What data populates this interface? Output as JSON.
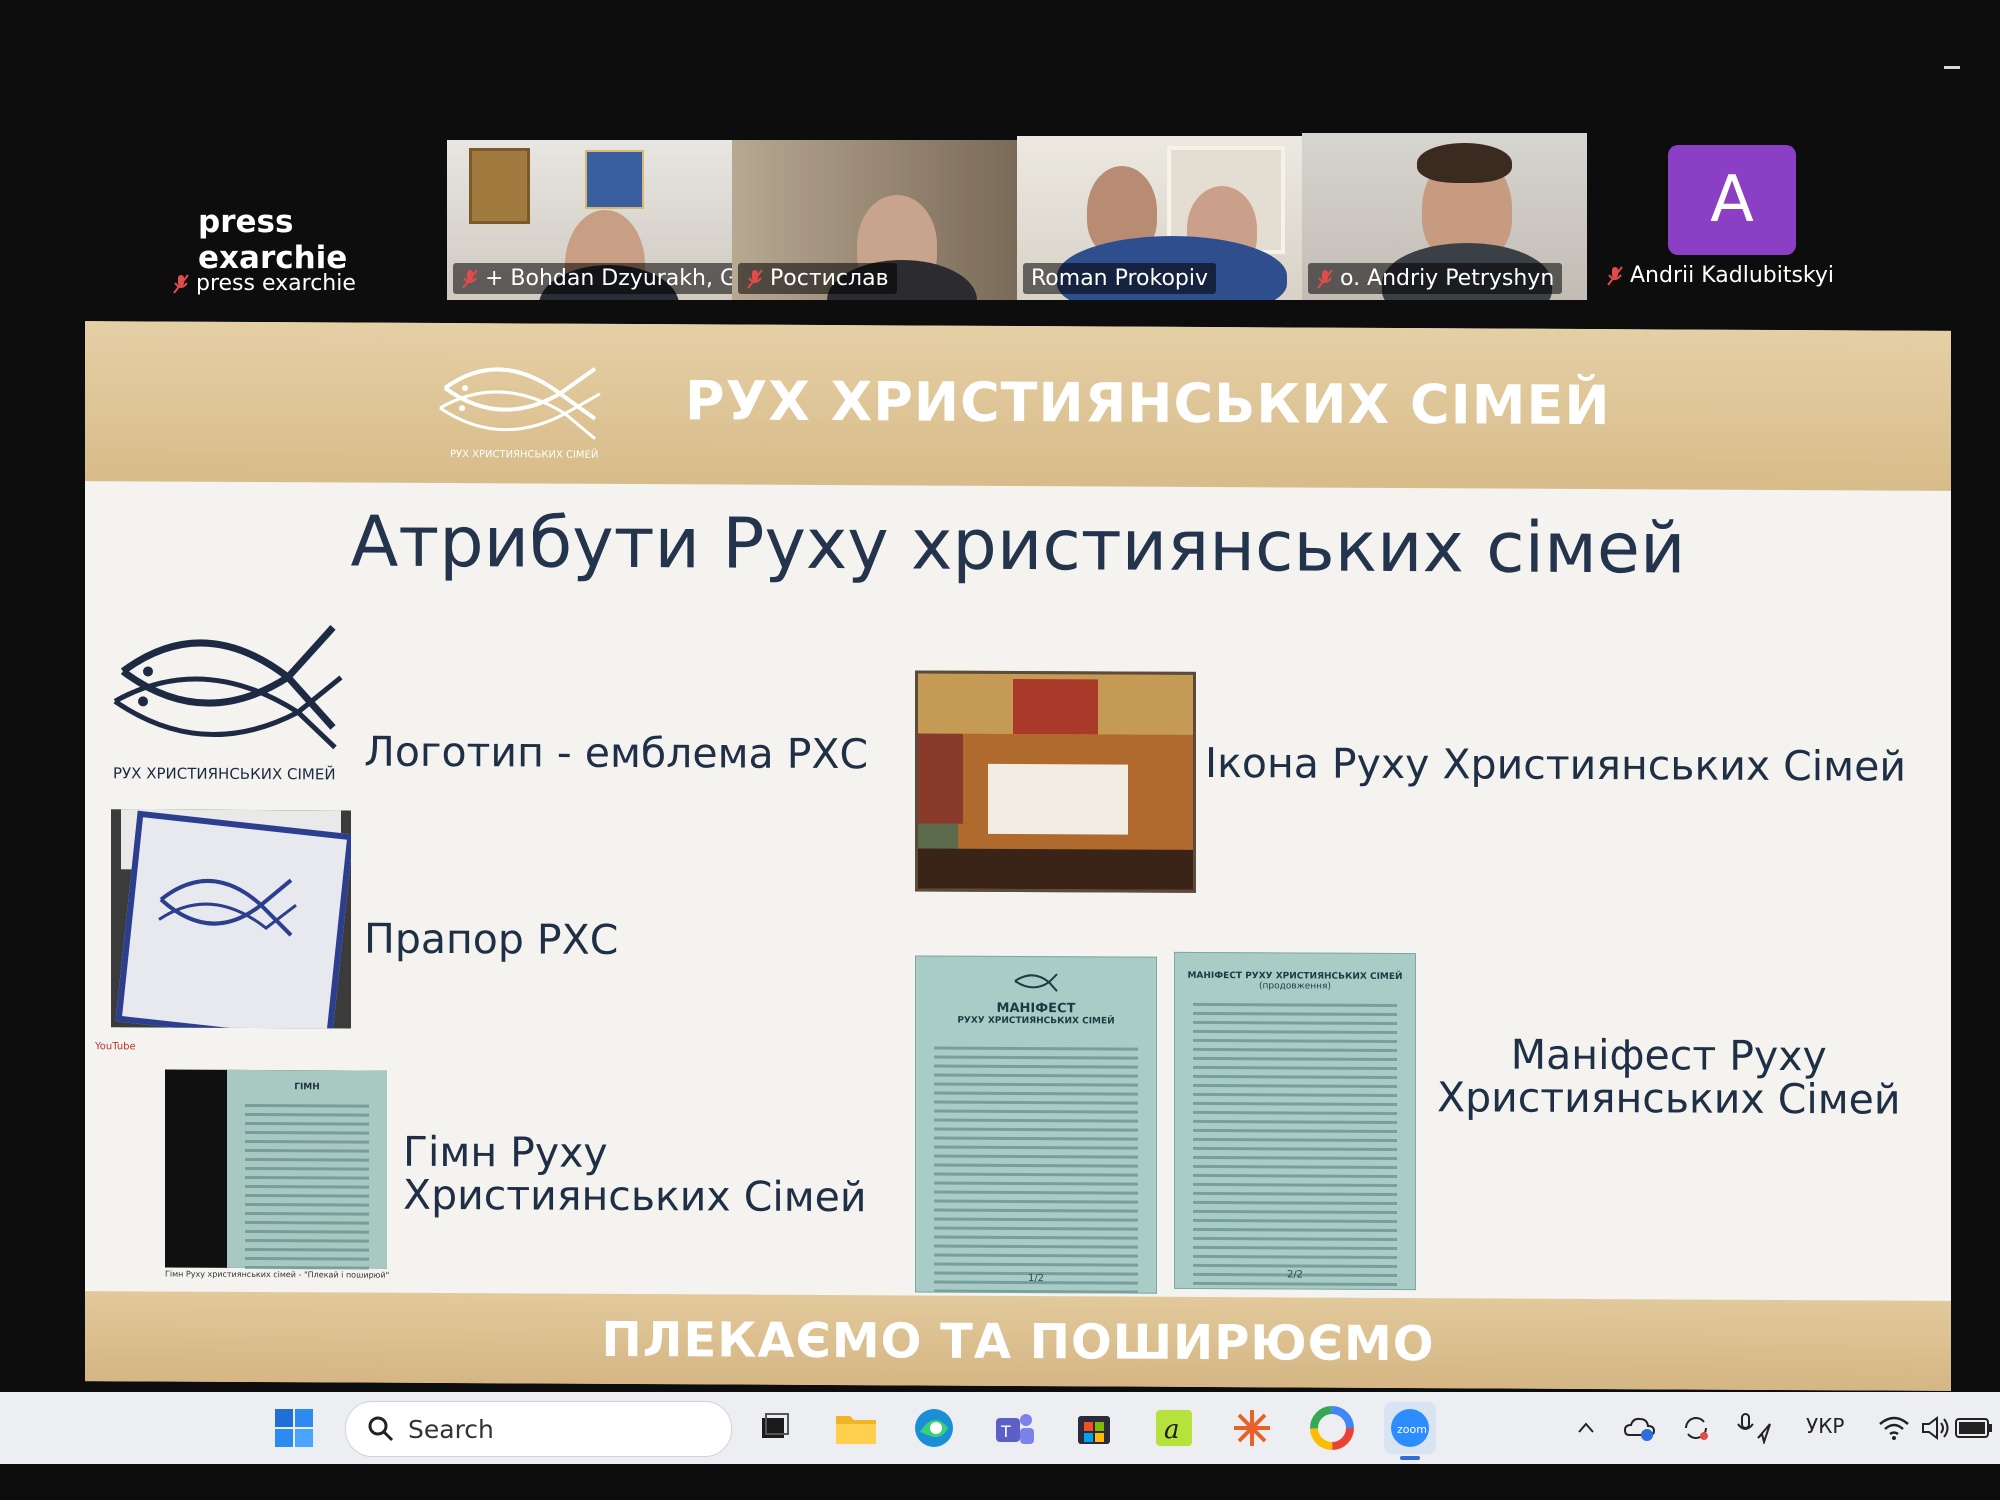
{
  "meeting": {
    "self": {
      "name_big": "press exarchie",
      "label": "press exarchie"
    },
    "participants": [
      {
        "label": "+ Bohdan Dzyurakh, G..."
      },
      {
        "label": "Ростислав"
      },
      {
        "label": "Roman Prokopiv"
      },
      {
        "label": "o. Andriy Petryshyn"
      },
      {
        "label": "Andrii Kadlubitskyi",
        "initial": "A"
      }
    ],
    "colors": {
      "active_border": "#7fd36a",
      "avatar_bg": "#8a3fc4",
      "muted_mic": "#e24b4b"
    }
  },
  "slide": {
    "header_title": "РУХ ХРИСТИЯНСЬКИХ СІМЕЙ",
    "header_logo_text": "РУХ ХРИСТИЯНСЬКИХ СІМЕЙ",
    "main_title": "Атрибути Руху християнських сімей",
    "items": {
      "logo": "Логотип - емблема РХС",
      "flag": "Прапор РХС",
      "anthem_line1": "Гімн Руху",
      "anthem_line2": "Християнських Сімей",
      "icon": "Ікона Руху Християнських Сімей",
      "manifest_line1": "Маніфест Руху",
      "manifest_line2": "Християнських Сімей"
    },
    "video": {
      "platform": "YouTube",
      "page_title": "ГІМН",
      "caption": "Гімн Руху християнських сімей - \"Плекай і поширюй\""
    },
    "manifesto_pages": [
      {
        "title_1": "МАНІФЕСТ",
        "title_2": "РУХУ ХРИСТИЯНСЬКИХ СІМЕЙ",
        "page": "1/2"
      },
      {
        "title_1": "МАНІФЕСТ РУХУ ХРИСТИЯНСЬКИХ СІМЕЙ",
        "title_2": "(продовження)",
        "page": "2/2"
      }
    ],
    "footer_title": "ПЛЕКАЄМО ТА ПОШИРЮЄМО",
    "colors": {
      "band": "#d8bc8a",
      "title_text": "#24344d",
      "page_bg": "#a9cdc6"
    }
  },
  "taskbar": {
    "search_placeholder": "Search",
    "language": "УКР",
    "apps": [
      "windows-start-icon",
      "task-view-icon",
      "file-explorer-icon",
      "edge-icon",
      "teams-icon",
      "store-icon",
      "app-a-icon",
      "sparkle-app-icon",
      "color-app-icon",
      "zoom-icon"
    ]
  }
}
